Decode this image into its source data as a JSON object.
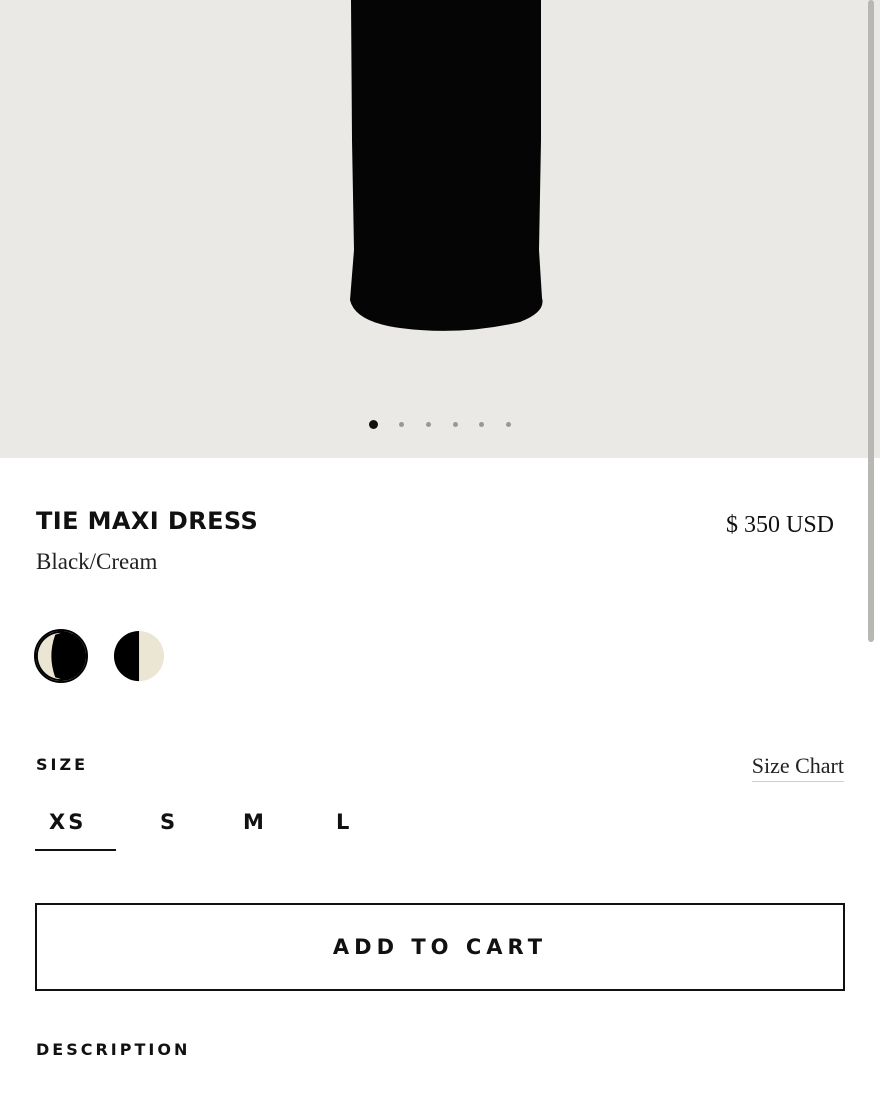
{
  "product": {
    "title": "TIE MAXI DRESS",
    "price": "$ 350 USD",
    "variant": "Black/Cream"
  },
  "carousel": {
    "slide_count": 6,
    "active_index": 0
  },
  "color_swatches": [
    {
      "name": "black-cream",
      "primary": "#000000",
      "secondary": "#ebe5d4",
      "selected": true
    },
    {
      "name": "cream-black",
      "primary": "#ebe5d4",
      "secondary": "#000000",
      "selected": false
    }
  ],
  "size": {
    "label": "SIZE",
    "chart_link": "Size Chart",
    "options": [
      "XS",
      "S",
      "M",
      "L"
    ],
    "selected": "XS"
  },
  "cart": {
    "button_label": "ADD TO CART"
  },
  "description": {
    "heading": "DESCRIPTION"
  },
  "colors": {
    "hero_bg": "#ebe9e5",
    "text": "#111111",
    "cream": "#ebe5d4"
  }
}
